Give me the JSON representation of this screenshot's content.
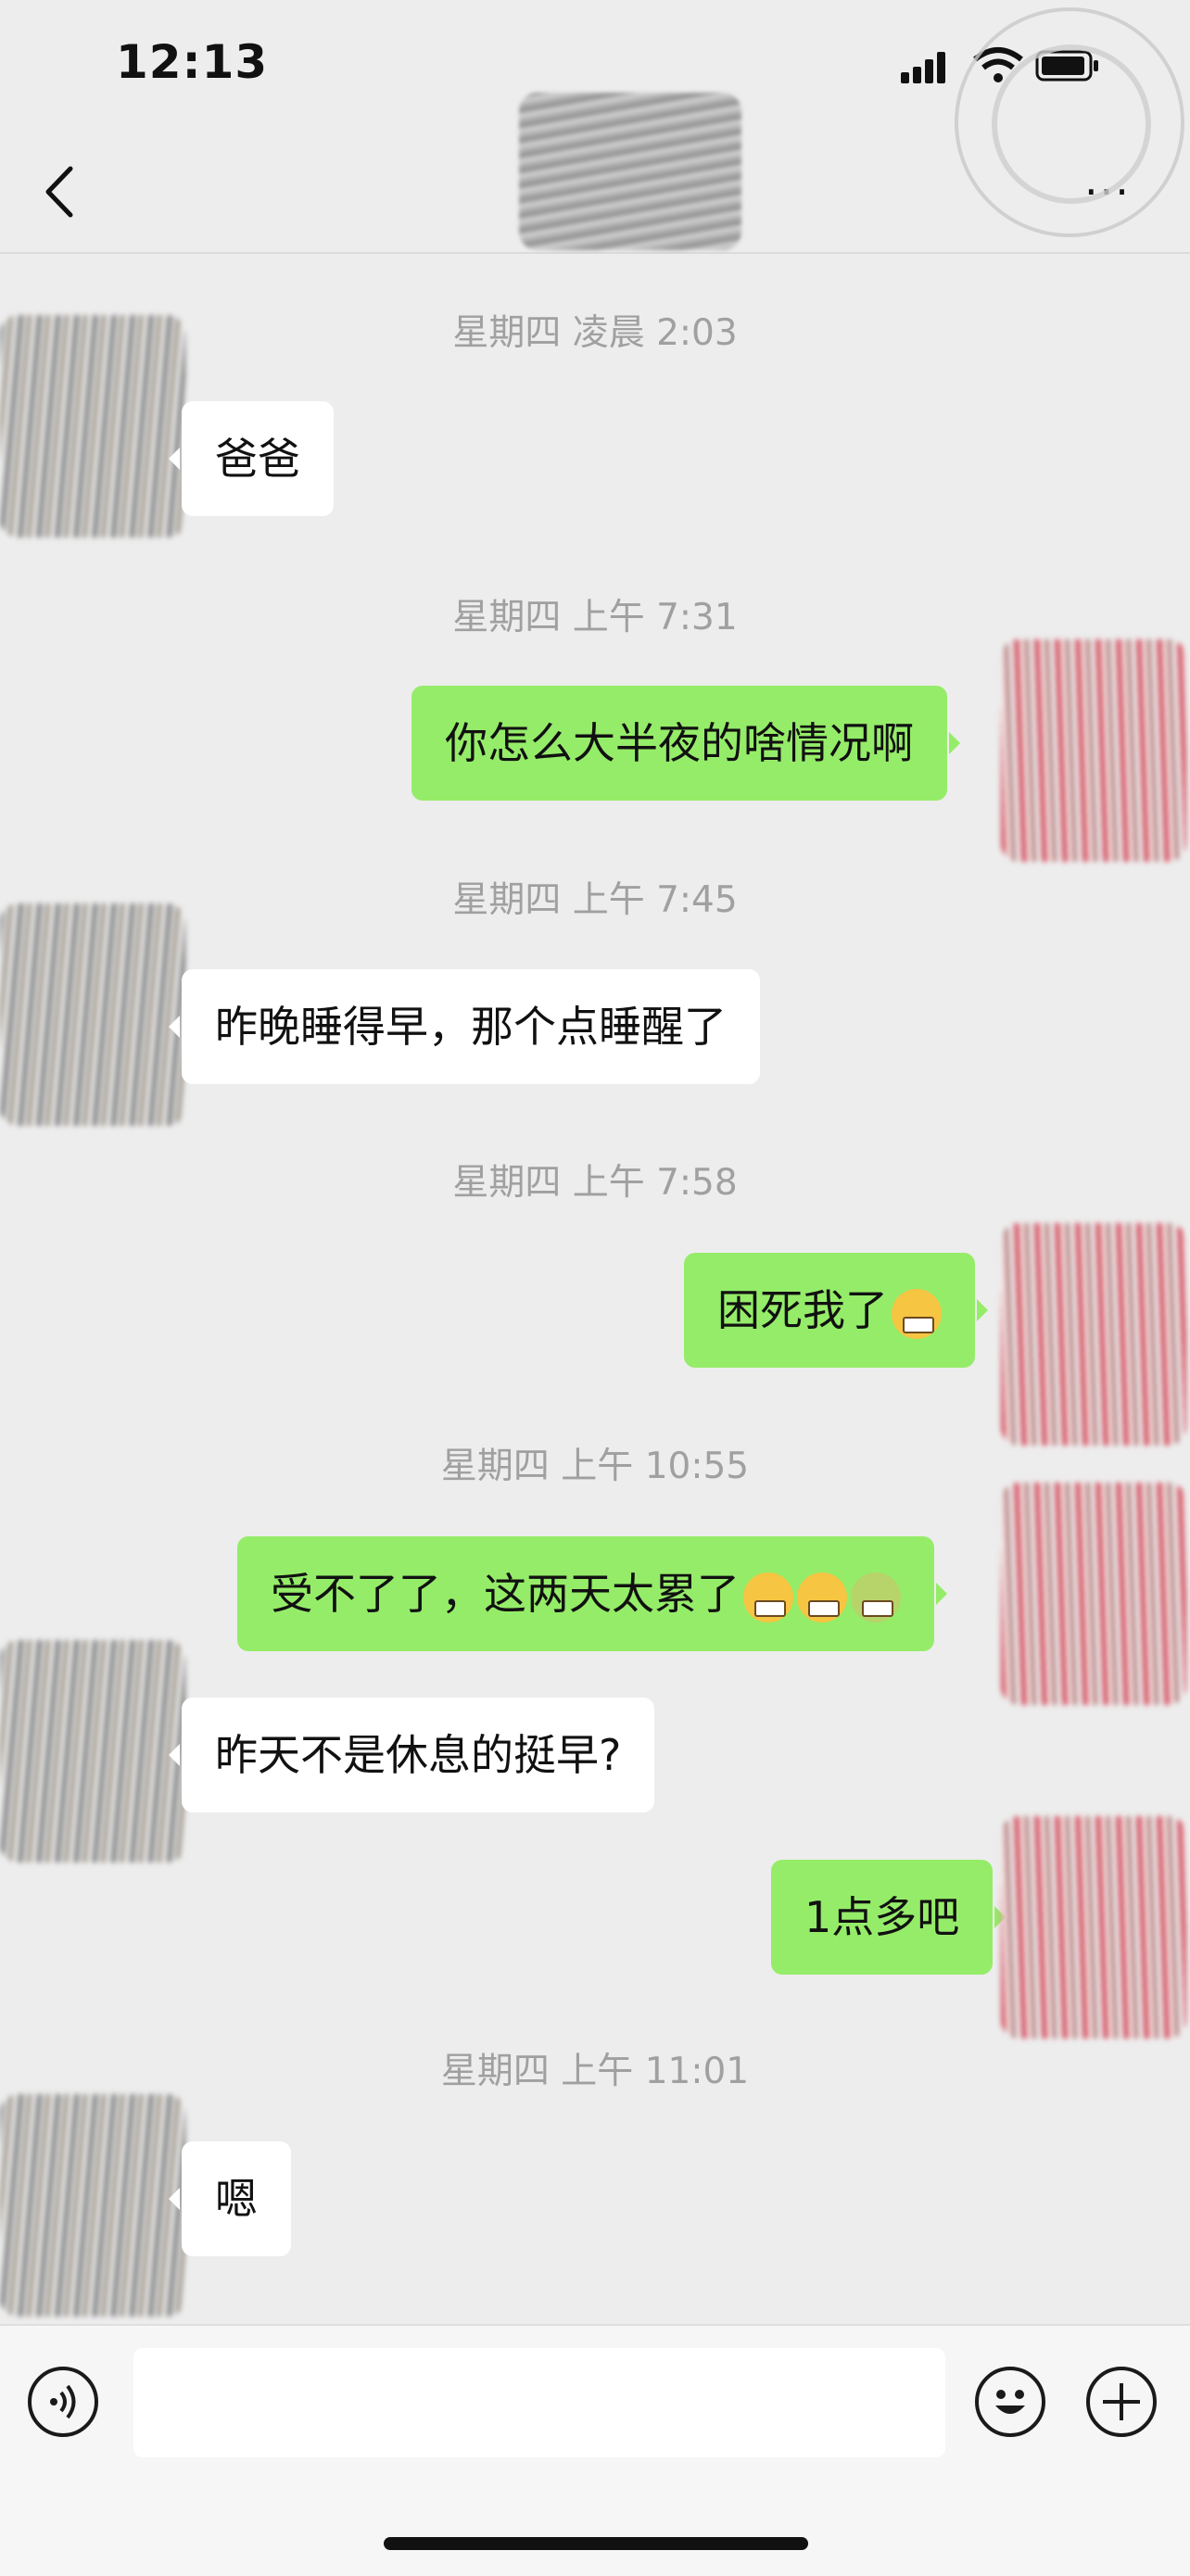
{
  "status_bar": {
    "time": "12:13"
  },
  "header": {
    "more_label": "···"
  },
  "messages": [
    {
      "type": "timestamp",
      "text": "星期四 凌晨 2:03"
    },
    {
      "type": "received",
      "text": "爸爸"
    },
    {
      "type": "timestamp",
      "text": "星期四 上午 7:31"
    },
    {
      "type": "sent",
      "text": "你怎么大半夜的啥情况啊"
    },
    {
      "type": "timestamp",
      "text": "星期四 上午 7:45"
    },
    {
      "type": "received",
      "text": "昨晚睡得早，那个点睡醒了"
    },
    {
      "type": "timestamp",
      "text": "星期四 上午 7:58"
    },
    {
      "type": "sent",
      "text": "困死我了"
    },
    {
      "type": "timestamp",
      "text": "星期四 上午 10:55"
    },
    {
      "type": "sent",
      "text": "受不了了，这两天太累了"
    },
    {
      "type": "received",
      "text": "昨天不是休息的挺早?"
    },
    {
      "type": "sent",
      "text": "1点多吧"
    },
    {
      "type": "timestamp",
      "text": "星期四 上午 11:01"
    },
    {
      "type": "received",
      "text": "嗯"
    }
  ],
  "input_bar": {
    "placeholder": ""
  },
  "icons": [
    "back-chevron-icon",
    "more-icon",
    "voice-icon",
    "emoji-icon",
    "plus-icon",
    "signal-icon",
    "wifi-icon",
    "battery-icon"
  ],
  "colors": {
    "sent_bubble": "#95ec69",
    "received_bubble": "#ffffff",
    "background": "#ededed"
  }
}
